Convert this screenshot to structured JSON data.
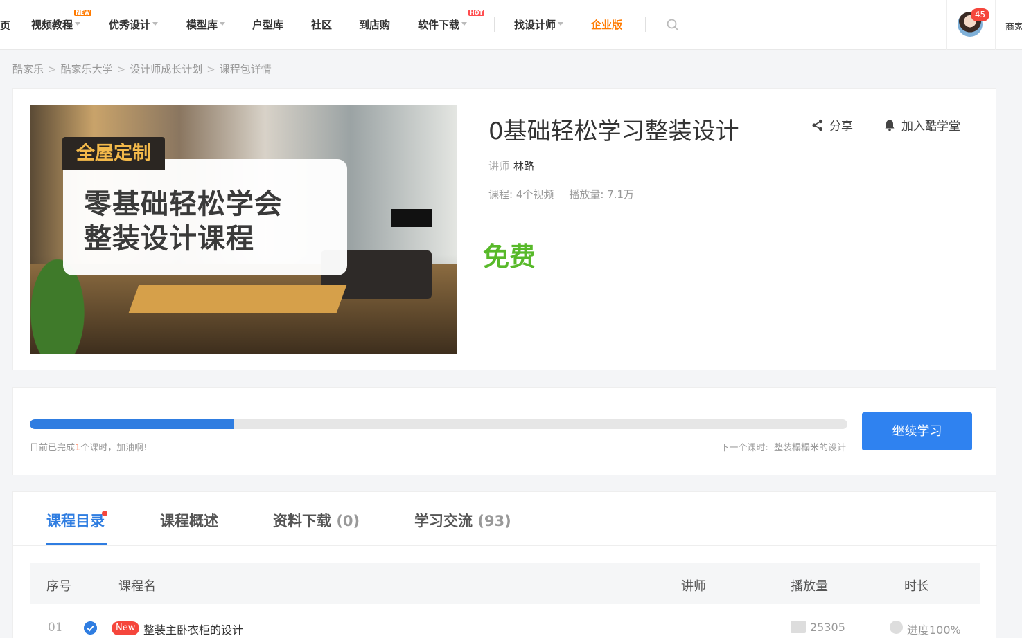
{
  "nav": {
    "edge_left": "页",
    "items": [
      {
        "label": "视频教程",
        "badge": "NEW"
      },
      {
        "label": "优秀设计"
      },
      {
        "label": "模型库"
      },
      {
        "label": "户型库"
      },
      {
        "label": "社区"
      },
      {
        "label": "到店购"
      },
      {
        "label": "软件下载",
        "badge": "HOT"
      },
      {
        "label": "找设计师"
      },
      {
        "label": "企业版"
      }
    ],
    "message_count": "45",
    "edge_right": "商家"
  },
  "breadcrumb": [
    "酷家乐",
    "酷家乐大学",
    "设计师成长计划",
    "课程包详情"
  ],
  "course": {
    "cover_tag": "全屋定制",
    "cover_line1": "零基础轻松学会",
    "cover_line2": "整装设计课程",
    "title": "0基础轻松学习整装设计",
    "share_label": "分享",
    "join_label": "加入酷学堂",
    "teacher_label": "讲师",
    "teacher_name": "林路",
    "lessons": "课程: 4个视频",
    "plays": "播放量: 7.1万",
    "price": "免费"
  },
  "progress": {
    "fraction": 0.25,
    "done_prefix": "目前已完成",
    "done_count": "1",
    "done_suffix": "个课时，加油啊!",
    "next_label": "下一个课时:",
    "next_lesson": "整装榻榻米的设计",
    "button_label": "继续学习"
  },
  "tabs": [
    {
      "label": "课程目录",
      "count": ""
    },
    {
      "label": "课程概述",
      "count": ""
    },
    {
      "label": "资料下载",
      "count": "(0)"
    },
    {
      "label": "学习交流",
      "count": "(93)"
    }
  ],
  "table": {
    "headers": {
      "index": "序号",
      "name": "课程名",
      "teacher": "讲师",
      "plays": "播放量",
      "duration": "时长"
    },
    "rows": [
      {
        "index": "01",
        "tag": "New",
        "name": "整装主卧衣柜的设计",
        "plays": "25305",
        "duration": "进度100%"
      }
    ]
  },
  "colors": {
    "accent": "#2f7de1",
    "price": "#58b92a",
    "enterprise": "#ff7a00",
    "badge": "#f5463c"
  }
}
